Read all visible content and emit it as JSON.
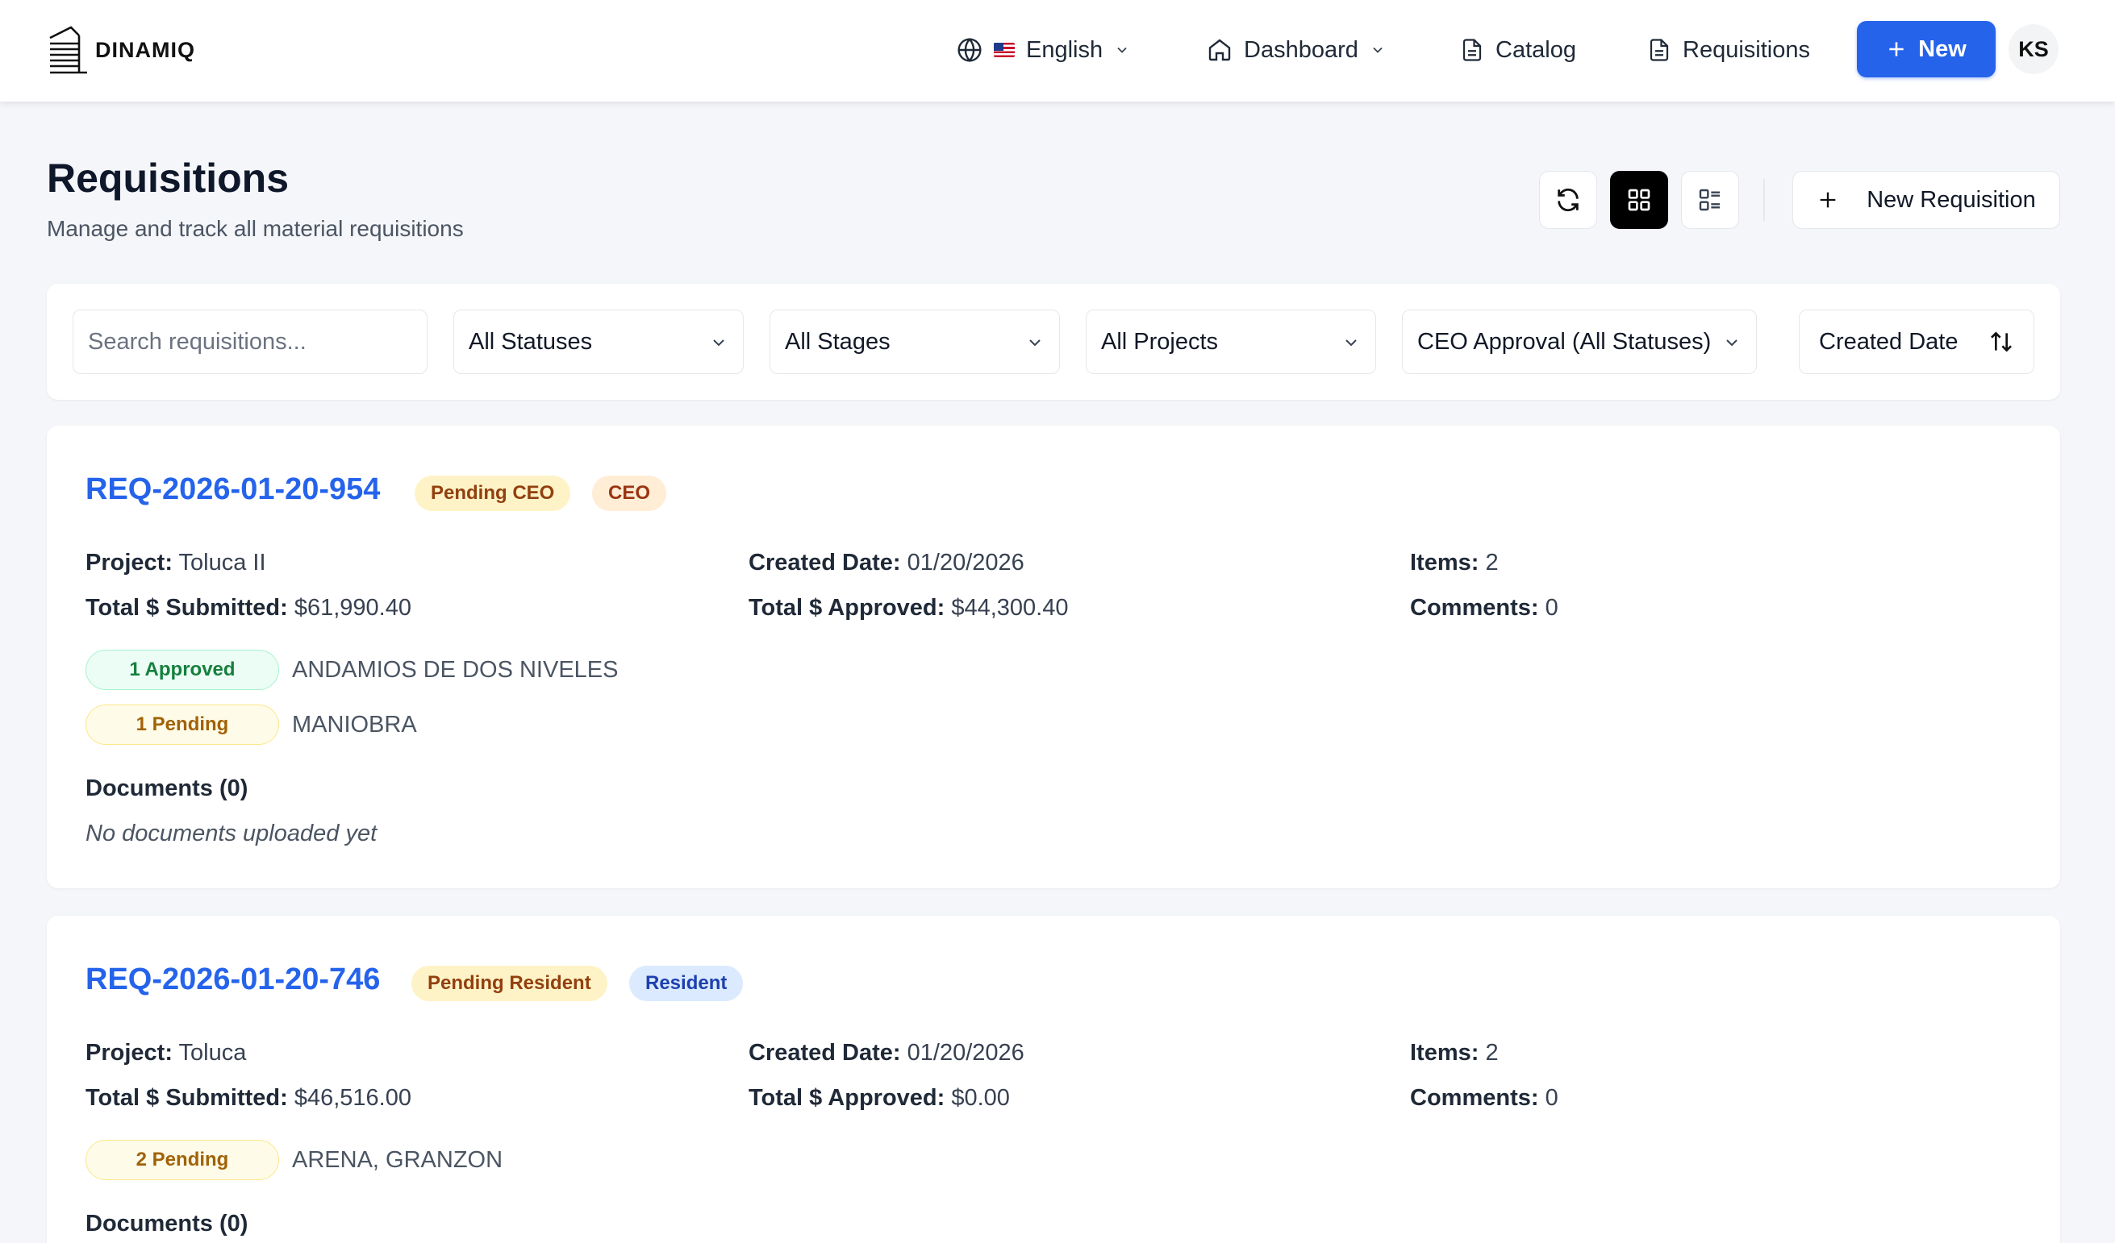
{
  "nav": {
    "logo_text": "DINAMIQ",
    "language": "English",
    "dashboard": "Dashboard",
    "catalog": "Catalog",
    "requisitions": "Requisitions",
    "new_label": "New",
    "user_initials": "KS"
  },
  "header": {
    "title": "Requisitions",
    "subtitle": "Manage and track all material requisitions",
    "new_requisition": "New Requisition"
  },
  "filters": {
    "search_placeholder": "Search requisitions...",
    "status": "All Statuses",
    "stage": "All Stages",
    "project": "All Projects",
    "approval": "CEO Approval (All Statuses)",
    "sort": "Created Date"
  },
  "labels": {
    "project": "Project:",
    "created_date": "Created Date:",
    "items": "Items:",
    "total_submitted": "Total $ Submitted:",
    "total_approved": "Total $ Approved:",
    "comments": "Comments:",
    "documents": "Documents (0)",
    "no_documents": "No documents uploaded yet"
  },
  "requisitions": [
    {
      "id": "REQ-2026-01-20-954",
      "status_badge": "Pending CEO",
      "stage_badge": "CEO",
      "project": "Toluca II",
      "created_date": "01/20/2026",
      "items": "2",
      "total_submitted": "$61,990.40",
      "total_approved": "$44,300.40",
      "comments": "0",
      "item_groups": [
        {
          "badge": "1 Approved",
          "names": "ANDAMIOS DE DOS NIVELES"
        },
        {
          "badge": "1 Pending",
          "names": "MANIOBRA"
        }
      ]
    },
    {
      "id": "REQ-2026-01-20-746",
      "status_badge": "Pending Resident",
      "stage_badge": "Resident",
      "project": "Toluca",
      "created_date": "01/20/2026",
      "items": "2",
      "total_submitted": "$46,516.00",
      "total_approved": "$0.00",
      "comments": "0",
      "item_groups": [
        {
          "badge": "2 Pending",
          "names": "ARENA, GRANZON"
        }
      ]
    }
  ],
  "colors": {
    "primary": "#2563eb",
    "background": "#f4f6f9",
    "approved_green": "#15803d",
    "pending_yellow": "#a16207"
  }
}
